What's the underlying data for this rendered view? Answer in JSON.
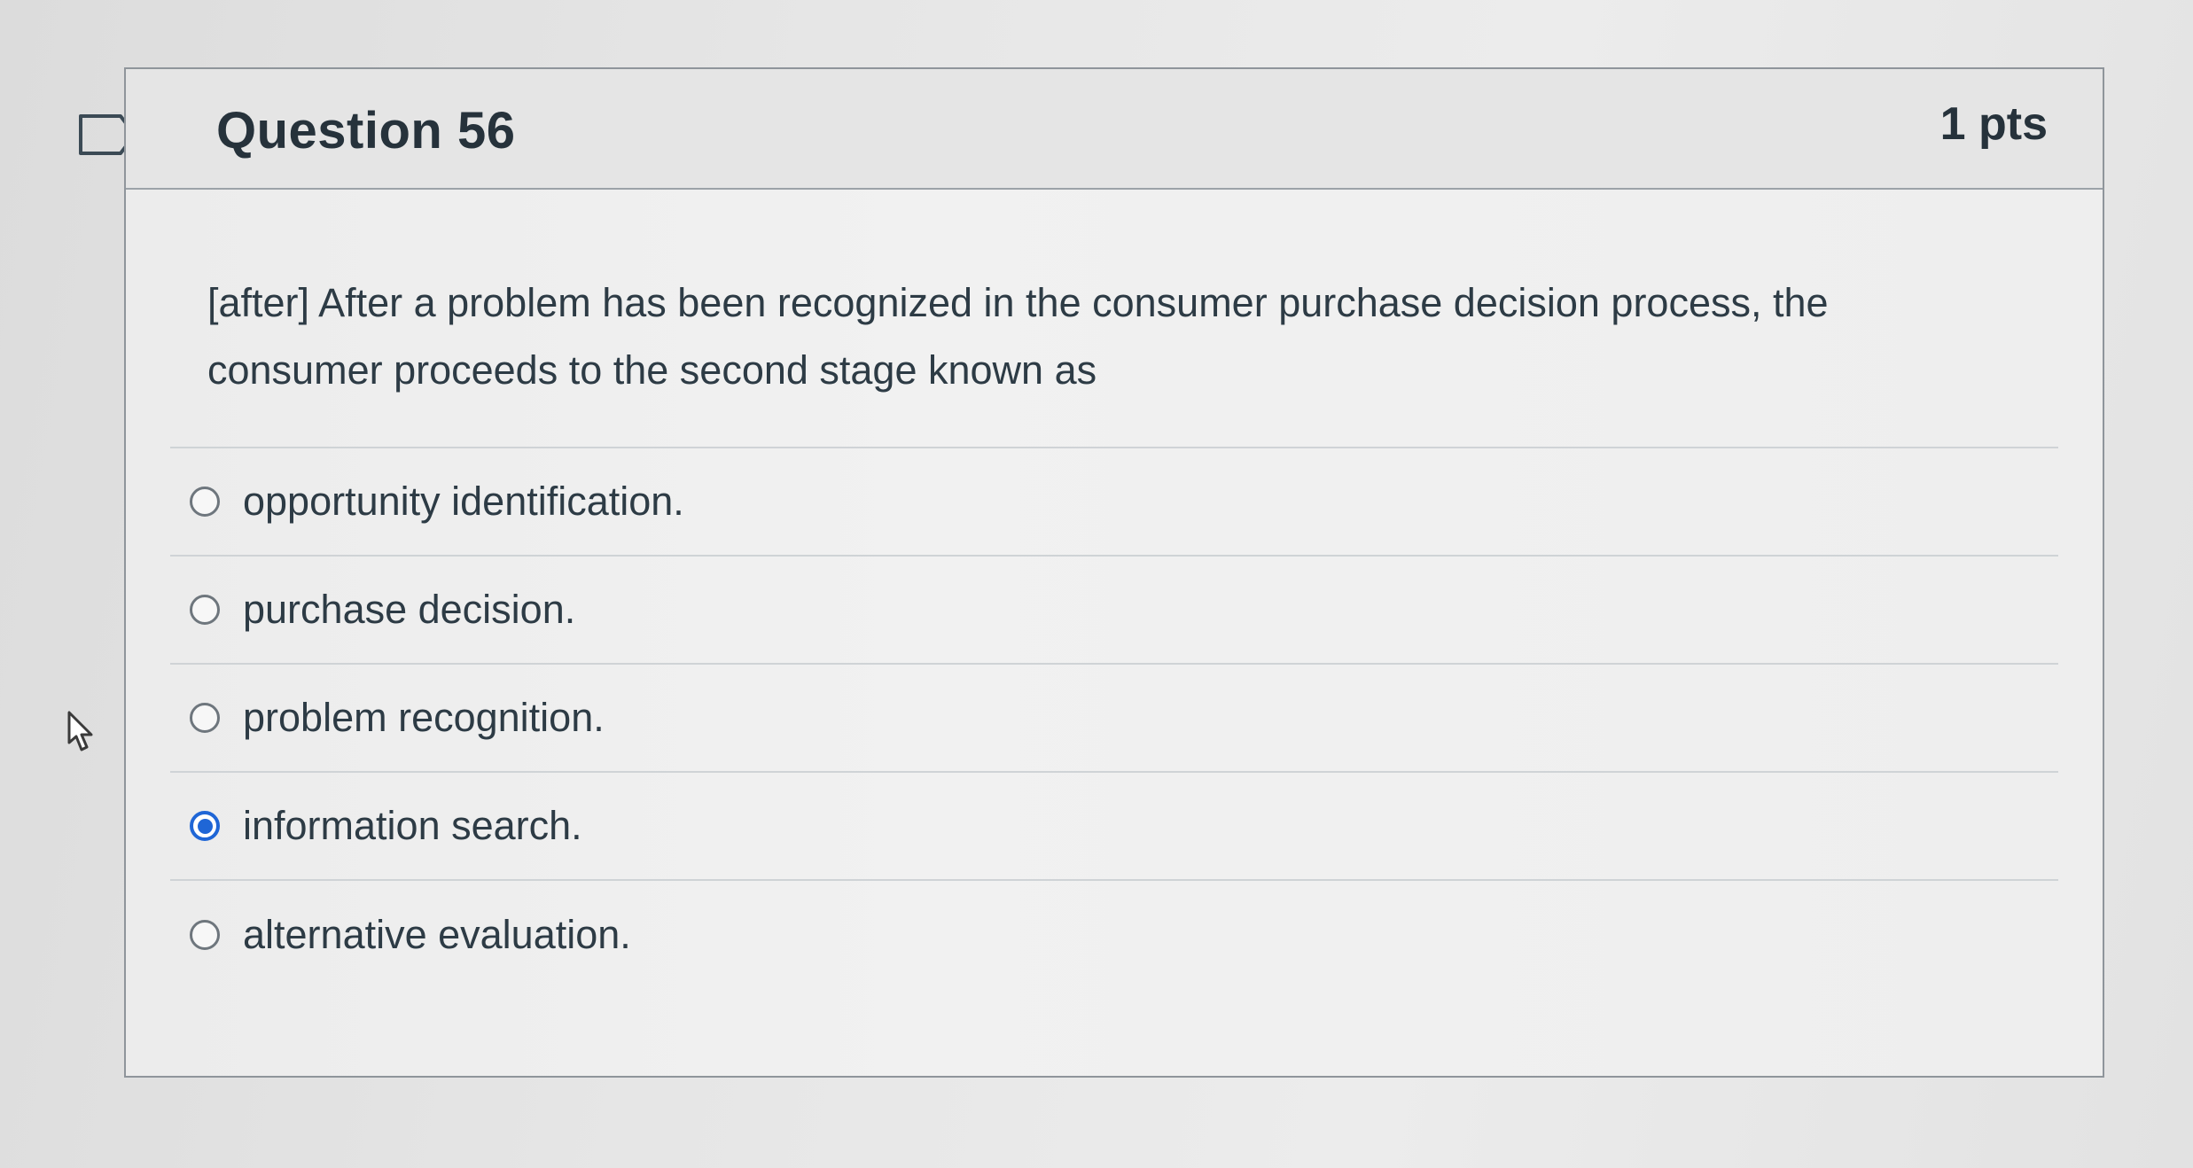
{
  "question": {
    "title": "Question 56",
    "points": "1 pts",
    "text": "[after] After a problem has been recognized in the consumer purchase decision process, the consumer proceeds to the second stage known as",
    "flag_icon": "flag-outline-icon",
    "answers": [
      {
        "label": "opportunity identification.",
        "selected": false
      },
      {
        "label": "purchase decision.",
        "selected": false
      },
      {
        "label": "problem recognition.",
        "selected": false
      },
      {
        "label": "information search.",
        "selected": true
      },
      {
        "label": "alternative evaluation.",
        "selected": false
      }
    ]
  },
  "colors": {
    "accent": "#1f66d6",
    "text": "#2d3b45"
  }
}
